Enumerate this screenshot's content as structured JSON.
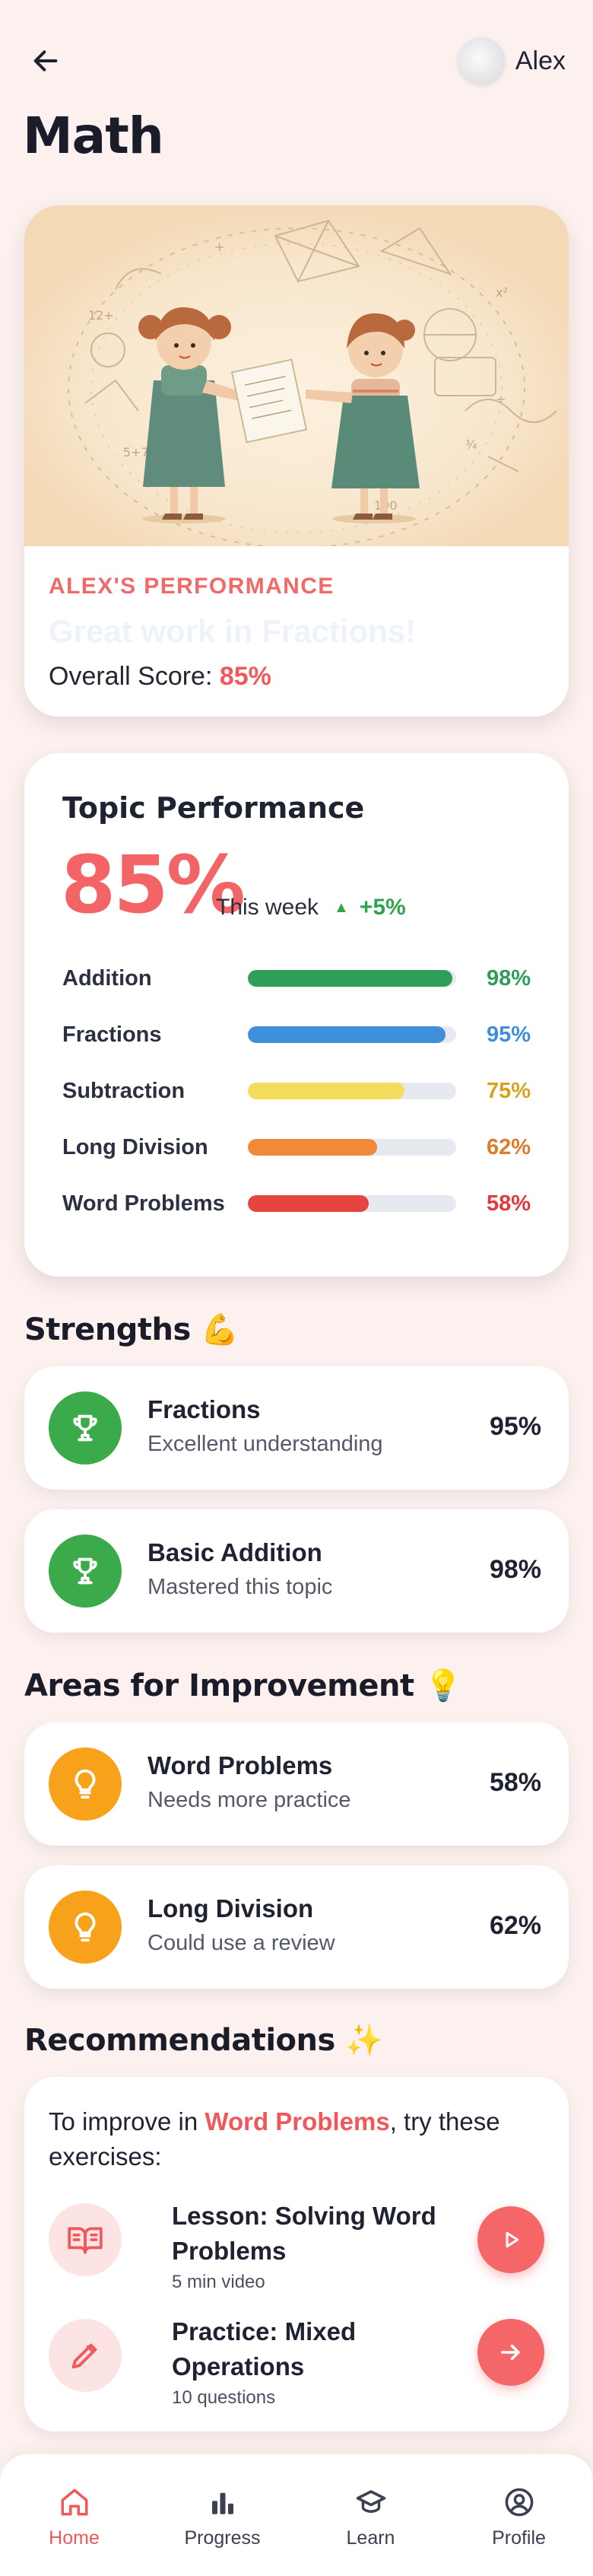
{
  "header": {
    "user_name": "Alex",
    "title": "Math"
  },
  "hero": {
    "eyebrow": "ALEX'S PERFORMANCE",
    "headline": "Great work in Fractions!",
    "score_label": "Overall Score:",
    "score_value": "85%"
  },
  "topic_performance": {
    "title": "Topic Performance",
    "score": "85%",
    "week_label": "This week",
    "week_delta": "+5%",
    "topics": [
      {
        "name": "Addition",
        "pct": "98%",
        "value": 98,
        "color": "#2f9e5a"
      },
      {
        "name": "Fractions",
        "pct": "95%",
        "value": 95,
        "color": "#3f8fdc"
      },
      {
        "name": "Subtraction",
        "pct": "75%",
        "value": 75,
        "color": "#f4dc5c"
      },
      {
        "name": "Long Division",
        "pct": "62%",
        "value": 62,
        "color": "#ee8a3a"
      },
      {
        "name": "Word Problems",
        "pct": "58%",
        "value": 58,
        "color": "#e5443f"
      }
    ],
    "pct_colors": [
      "#2f9e5a",
      "#3f8fdc",
      "#d9a21b",
      "#e07b28",
      "#e03a3a"
    ]
  },
  "strengths": {
    "title": "Strengths 💪",
    "items": [
      {
        "title": "Fractions",
        "subtitle": "Excellent understanding",
        "pct": "95%",
        "icon": "trophy-icon"
      },
      {
        "title": "Basic Addition",
        "subtitle": "Mastered this topic",
        "pct": "98%",
        "icon": "trophy-icon"
      }
    ]
  },
  "improvement": {
    "title": "Areas for Improvement 💡",
    "items": [
      {
        "title": "Word Problems",
        "subtitle": "Needs more practice",
        "pct": "58%",
        "icon": "lightbulb-icon"
      },
      {
        "title": "Long Division",
        "subtitle": "Could use a review",
        "pct": "62%",
        "icon": "lightbulb-icon"
      }
    ]
  },
  "recommendations": {
    "title": "Recommendations ✨",
    "intro_before": "To improve in ",
    "intro_highlight": "Word Problems",
    "intro_after": ", try these exercises:",
    "items": [
      {
        "title": "Lesson: Solving Word Problems",
        "subtitle": "5 min video",
        "icon": "book-icon",
        "action_icon": "play-icon"
      },
      {
        "title": "Practice: Mixed Operations",
        "subtitle": "10 questions",
        "icon": "pencil-icon",
        "action_icon": "arrow-right-icon"
      }
    ]
  },
  "nav": {
    "items": [
      {
        "label": "Home",
        "icon": "home-icon",
        "active": true
      },
      {
        "label": "Progress",
        "icon": "bar-chart-icon",
        "active": false
      },
      {
        "label": "Learn",
        "icon": "graduation-cap-icon",
        "active": false
      },
      {
        "label": "Profile",
        "icon": "profile-icon",
        "active": false
      }
    ]
  },
  "colors": {
    "accent": "#f0585a",
    "background": "#fdf1f0",
    "success": "#3aaa4a",
    "warning": "#f7a21a"
  }
}
